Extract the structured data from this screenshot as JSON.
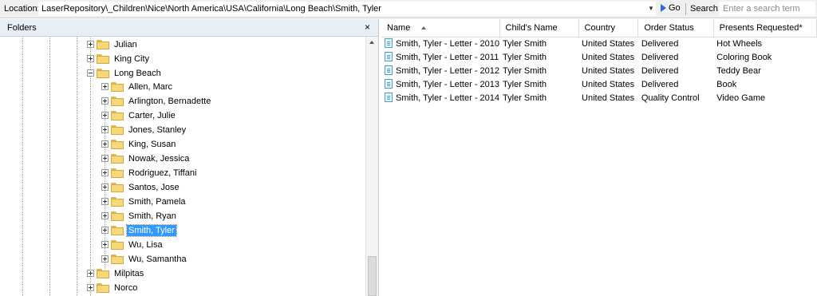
{
  "location": {
    "label": "Location:",
    "path": "LaserRepository\\_Children\\Nice\\North America\\USA\\California\\Long Beach\\Smith, Tyler",
    "go_label": "Go"
  },
  "search": {
    "label": "Search:",
    "placeholder": "Enter a search term"
  },
  "folders_pane": {
    "title": "Folders",
    "close_glyph": "×",
    "nodes": [
      {
        "label": "Julian"
      },
      {
        "label": "King City"
      },
      {
        "label": "Long Beach"
      },
      {
        "label": "Allen, Marc"
      },
      {
        "label": "Arlington, Bernadette"
      },
      {
        "label": "Carter, Julie"
      },
      {
        "label": "Jones, Stanley"
      },
      {
        "label": "King, Susan"
      },
      {
        "label": "Nowak, Jessica"
      },
      {
        "label": "Rodriguez, Tiffani"
      },
      {
        "label": "Santos, Jose"
      },
      {
        "label": "Smith, Pamela"
      },
      {
        "label": "Smith, Ryan"
      },
      {
        "label": "Smith, Tyler",
        "selected": true
      },
      {
        "label": "Wu, Lisa"
      },
      {
        "label": "Wu, Samantha"
      },
      {
        "label": "Milpitas"
      },
      {
        "label": "Norco"
      }
    ]
  },
  "list": {
    "columns": [
      "Name",
      "Child's Name",
      "Country",
      "Order Status",
      "Presents Requested*"
    ],
    "rows": [
      [
        "Smith, Tyler - Letter - 2010",
        "Tyler Smith",
        "United States",
        "Delivered",
        "Hot Wheels"
      ],
      [
        "Smith, Tyler - Letter - 2011",
        "Tyler Smith",
        "United States",
        "Delivered",
        "Coloring Book"
      ],
      [
        "Smith, Tyler - Letter - 2012",
        "Tyler Smith",
        "United States",
        "Delivered",
        "Teddy Bear"
      ],
      [
        "Smith, Tyler - Letter - 2013",
        "Tyler Smith",
        "United States",
        "Delivered",
        "Book"
      ],
      [
        "Smith, Tyler - Letter - 2014",
        "Tyler Smith",
        "United States",
        "Quality Control",
        "Video Game"
      ]
    ]
  },
  "icons": {
    "folder": "folder-icon",
    "document": "document-icon",
    "go": "go-arrow-icon",
    "close": "close-icon",
    "dropdown": "chevron-down-icon"
  },
  "colors": {
    "selection": "#3399ff",
    "go_arrow": "#2a6fd6",
    "pane_header": "#e8eef6",
    "folder": "#f6d77a"
  }
}
